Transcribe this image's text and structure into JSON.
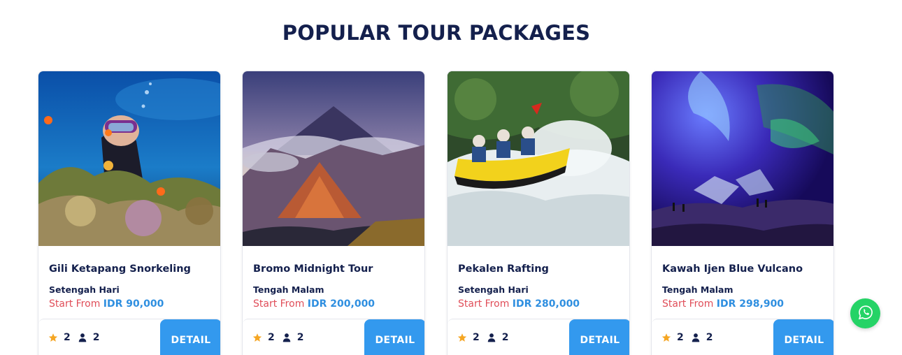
{
  "section": {
    "title": "POPULAR TOUR PACKAGES"
  },
  "price_label": "Start From",
  "detail_label": "DETAIL",
  "packages": [
    {
      "title": "Gili Ketapang Snorkeling",
      "duration": "Setengah Hari",
      "price": "IDR 90,000",
      "rating": "2",
      "persons": "2",
      "image": "snorkeling-photo"
    },
    {
      "title": "Bromo Midnight Tour",
      "duration": "Tengah Malam",
      "price": "IDR 200,000",
      "rating": "2",
      "persons": "2",
      "image": "volcano-photo"
    },
    {
      "title": "Pekalen Rafting",
      "duration": "Setengah Hari",
      "price": "IDR 280,000",
      "rating": "2",
      "persons": "2",
      "image": "rafting-photo"
    },
    {
      "title": "Kawah Ijen Blue Vulcano",
      "duration": "Tengah Malam",
      "price": "IDR 298,900",
      "rating": "2",
      "persons": "2",
      "image": "blue-fire-photo"
    }
  ],
  "colors": {
    "title": "#14204d",
    "accent": "#3399ee",
    "price_label": "#e04e59",
    "price_value": "#2f8fe0",
    "star": "#f5a623",
    "whatsapp": "#25d366"
  },
  "icons": {
    "rating": "star-icon",
    "persons": "user-icon",
    "chat": "whatsapp-icon"
  }
}
